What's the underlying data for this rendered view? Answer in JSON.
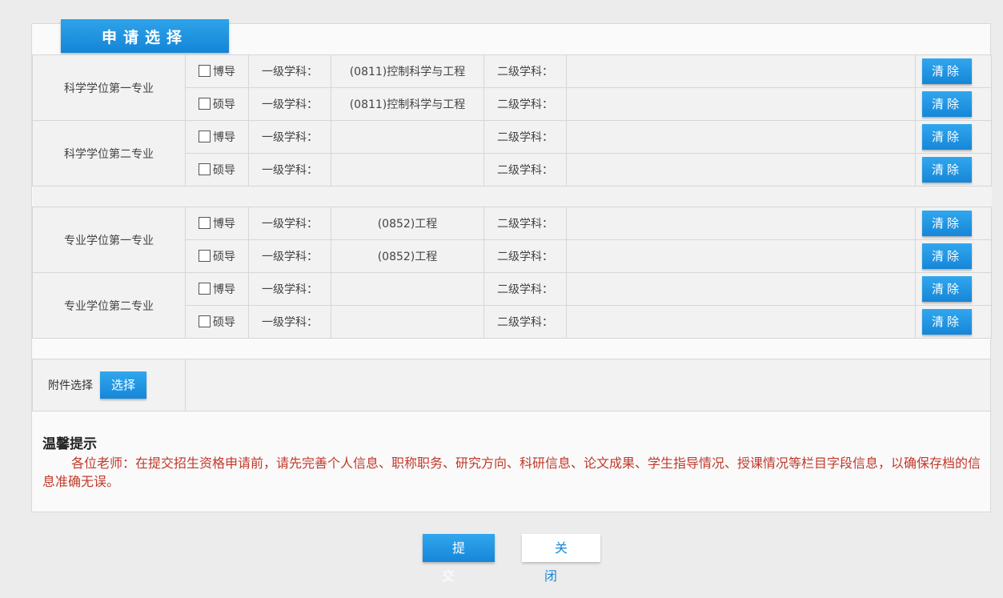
{
  "header": {
    "title": "申请选择"
  },
  "rows": [
    {
      "group": "科学学位第一专业",
      "type": "博导",
      "field1_label": "一级学科：",
      "field1_value": "(0811)控制科学与工程",
      "field2_label": "二级学科：",
      "field2_value": "",
      "clear": "清除"
    },
    {
      "group": "",
      "type": "硕导",
      "field1_label": "一级学科：",
      "field1_value": "(0811)控制科学与工程",
      "field2_label": "二级学科：",
      "field2_value": "",
      "clear": "清除"
    },
    {
      "group": "科学学位第二专业",
      "type": "博导",
      "field1_label": "一级学科：",
      "field1_value": "",
      "field2_label": "二级学科：",
      "field2_value": "",
      "clear": "清除"
    },
    {
      "group": "",
      "type": "硕导",
      "field1_label": "一级学科：",
      "field1_value": "",
      "field2_label": "二级学科：",
      "field2_value": "",
      "clear": "清除"
    },
    {
      "group": "专业学位第一专业",
      "type": "博导",
      "field1_label": "一级学科：",
      "field1_value": "(0852)工程",
      "field2_label": "二级学科：",
      "field2_value": "",
      "clear": "清除"
    },
    {
      "group": "",
      "type": "硕导",
      "field1_label": "一级学科：",
      "field1_value": "(0852)工程",
      "field2_label": "二级学科：",
      "field2_value": "",
      "clear": "清除"
    },
    {
      "group": "专业学位第二专业",
      "type": "博导",
      "field1_label": "一级学科：",
      "field1_value": "",
      "field2_label": "二级学科：",
      "field2_value": "",
      "clear": "清除"
    },
    {
      "group": "",
      "type": "硕导",
      "field1_label": "一级学科：",
      "field1_value": "",
      "field2_label": "二级学科：",
      "field2_value": "",
      "clear": "清除"
    }
  ],
  "attachment": {
    "label": "附件选择",
    "button": "选择"
  },
  "tips": {
    "title": "温馨提示",
    "body": "各位老师：在提交招生资格申请前，请先完善个人信息、职称职务、研究方向、科研信息、论文成果、学生指导情况、授课情况等栏目字段信息，以确保存档的信息准确无误。"
  },
  "actions": {
    "submit": "提交",
    "close": "关闭"
  },
  "colors": {
    "accent": "#1686d8",
    "tip_text": "#c0392b"
  }
}
